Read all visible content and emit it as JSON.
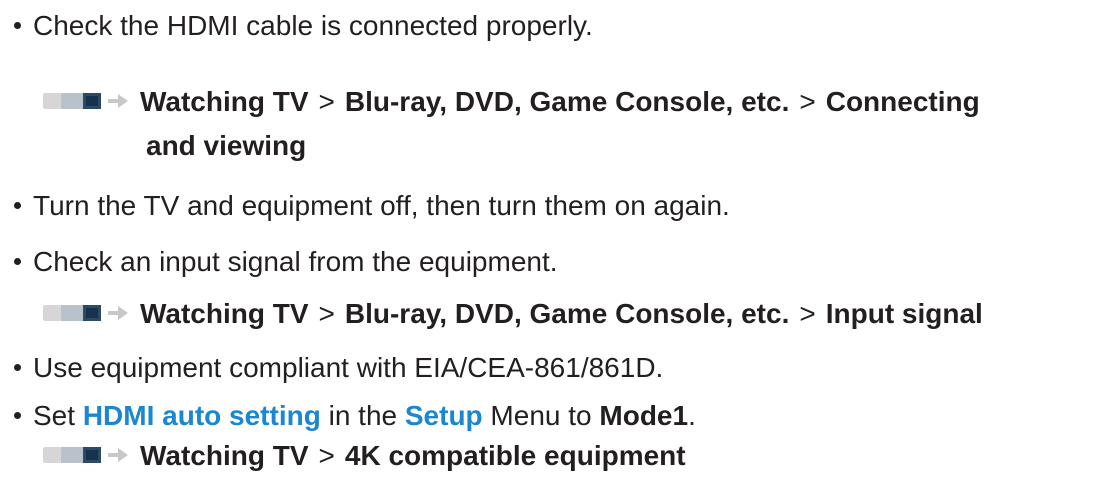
{
  "items": [
    {
      "text": "Check the HDMI cable is connected properly."
    },
    {
      "ref": {
        "icon": "reference-arrow-icon",
        "path": [
          "Watching TV",
          "Blu-ray, DVD, Game Console, etc.",
          "Connecting"
        ],
        "continuation": "and viewing",
        "separator": ">"
      }
    },
    {
      "text": "Turn the TV and equipment off, then turn them on again."
    },
    {
      "text": "Check an input signal from the equipment."
    },
    {
      "ref": {
        "icon": "reference-arrow-icon",
        "path": [
          "Watching TV",
          "Blu-ray, DVD, Game Console, etc.",
          "Input signal"
        ],
        "separator": ">"
      }
    },
    {
      "text": "Use equipment compliant with EIA/CEA-861/861D."
    },
    {
      "parts": {
        "p1": "Set ",
        "link1": "HDMI auto setting",
        "p2": " in the ",
        "link2": "Setup",
        "p3": " Menu to ",
        "bold1": "Mode1",
        "p4": "."
      }
    },
    {
      "ref": {
        "icon": "reference-arrow-icon",
        "path": [
          "Watching TV",
          "4K compatible equipment"
        ],
        "separator": ">"
      }
    }
  ],
  "colors": {
    "text": "#231f20",
    "link": "#1a87d0",
    "icon_gray": "#c9c9c9",
    "icon_dark": "#2c4a66",
    "arrow": "#c8c8c8"
  }
}
